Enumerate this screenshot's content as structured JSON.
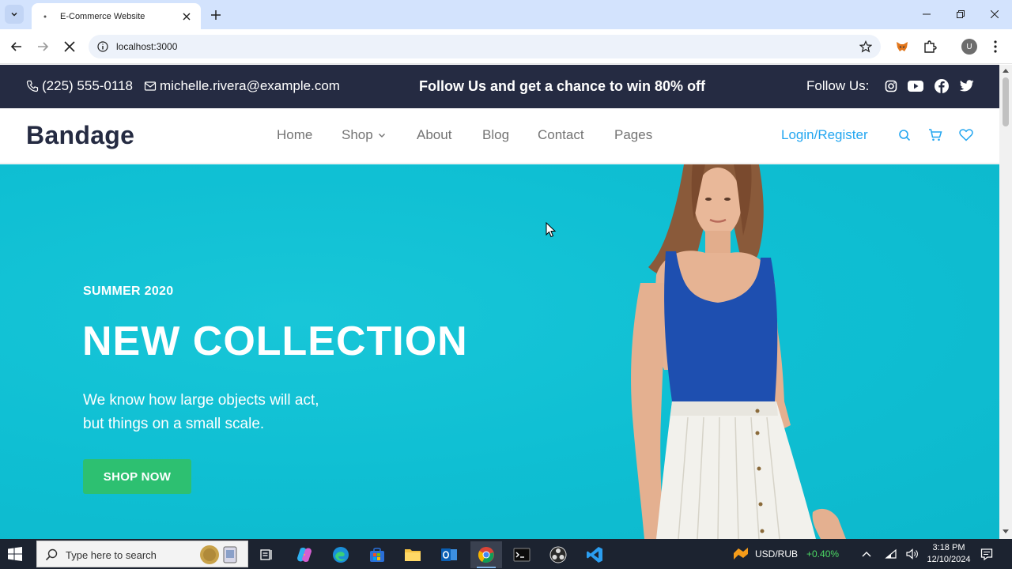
{
  "browser": {
    "tab_title": "E-Commerce Website",
    "url": "localhost:3000",
    "profile_initial": "U"
  },
  "topbar": {
    "phone": "(225) 555-0118",
    "email": "michelle.rivera@example.com",
    "promo": "Follow Us and get a chance to win 80% off",
    "follow_label": "Follow Us:"
  },
  "navbar": {
    "brand": "Bandage",
    "links": [
      "Home",
      "Shop",
      "About",
      "Blog",
      "Contact",
      "Pages"
    ],
    "login": "Login/Register"
  },
  "hero": {
    "eyebrow": "SUMMER 2020",
    "headline": "NEW COLLECTION",
    "sub_line1": "We know how large objects will act,",
    "sub_line2": "but things on a small scale.",
    "button": "SHOP NOW",
    "bg_color": "#0fbfd3",
    "button_color": "#2dc071"
  },
  "taskbar": {
    "search_placeholder": "Type here to search",
    "currency": "USD/RUB",
    "change": "+0.40%",
    "time": "3:18 PM",
    "date": "12/10/2024"
  },
  "colors": {
    "dark": "#252b42",
    "link_blue": "#23a6f0",
    "nav_gray": "#737373"
  }
}
